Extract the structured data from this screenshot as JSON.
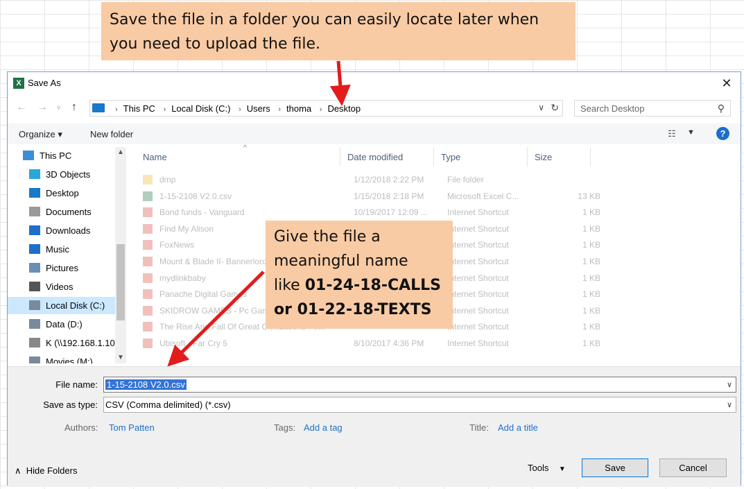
{
  "callouts": {
    "top": {
      "line1": "Save the file in a folder you can easily locate later when",
      "line2": "you need to upload the file."
    },
    "mid": {
      "line1": "Give the file a",
      "line2": "meaningful name",
      "line3_prefix": "like ",
      "line3_bold": "01-24-18-CALLS",
      "line4_bold": "or 01-22-18-TEXTS"
    }
  },
  "dialog": {
    "title": "Save As",
    "breadcrumb": [
      "This PC",
      "Local Disk (C:)",
      "Users",
      "thoma",
      "Desktop"
    ],
    "search_placeholder": "Search Desktop",
    "toolbar": {
      "organize": "Organize ▾",
      "new_folder": "New folder"
    }
  },
  "nav_pane": [
    {
      "label": "This PC",
      "icon": "computer-icon",
      "indent": 0
    },
    {
      "label": "3D Objects",
      "icon": "3d-objects-icon",
      "indent": 1
    },
    {
      "label": "Desktop",
      "icon": "desktop-icon",
      "indent": 1
    },
    {
      "label": "Documents",
      "icon": "documents-icon",
      "indent": 1
    },
    {
      "label": "Downloads",
      "icon": "downloads-icon",
      "indent": 1
    },
    {
      "label": "Music",
      "icon": "music-icon",
      "indent": 1
    },
    {
      "label": "Pictures",
      "icon": "pictures-icon",
      "indent": 1
    },
    {
      "label": "Videos",
      "icon": "videos-icon",
      "indent": 1
    },
    {
      "label": "Local Disk (C:)",
      "icon": "drive-icon",
      "indent": 1,
      "selected": true
    },
    {
      "label": "Data (D:)",
      "icon": "drive-icon",
      "indent": 1
    },
    {
      "label": "K (\\\\192.168.1.10",
      "icon": "network-drive-icon",
      "indent": 1
    },
    {
      "label": "Movies (M:)",
      "icon": "drive-icon",
      "indent": 1
    }
  ],
  "file_list": {
    "columns": [
      "Name",
      "Date modified",
      "Type",
      "Size"
    ],
    "rows": [
      {
        "name": "dmp",
        "date": "1/12/2018 2:22 PM",
        "type": "File folder",
        "size": ""
      },
      {
        "name": "1-15-2108 V2.0.csv",
        "date": "1/15/2018 2:18 PM",
        "type": "Microsoft Excel C...",
        "size": "13 KB"
      },
      {
        "name": "Bond funds - Vanguard",
        "date": "10/19/2017 12:09 ...",
        "type": "Internet Shortcut",
        "size": "1 KB"
      },
      {
        "name": "Find My Alison",
        "date": "",
        "type": "Internet Shortcut",
        "size": "1 KB"
      },
      {
        "name": "FoxNews",
        "date": "",
        "type": "Internet Shortcut",
        "size": "1 KB"
      },
      {
        "name": "Mount & Blade II- Bannerlord",
        "date": "",
        "type": "Internet Shortcut",
        "size": "1 KB"
      },
      {
        "name": "mydlinkbaby",
        "date": "",
        "type": "Internet Shortcut",
        "size": "1 KB"
      },
      {
        "name": "Panache Digital Games",
        "date": "",
        "type": "Internet Shortcut",
        "size": "1 KB"
      },
      {
        "name": "SKIDROW GAMES - Pc Games",
        "date": "",
        "type": "Internet Shortcut",
        "size": "1 KB"
      },
      {
        "name": "The Rise And Fall Of Great Civilizations - V...",
        "date": "",
        "type": "Internet Shortcut",
        "size": "1 KB"
      },
      {
        "name": "Ubisoft - Far Cry 5",
        "date": "8/10/2017 4:36 PM",
        "type": "Internet Shortcut",
        "size": "1 KB"
      }
    ]
  },
  "bottom": {
    "file_name_label": "File name:",
    "file_name_value": "1-15-2108 V2.0.csv",
    "save_type_label": "Save as type:",
    "save_type_value": "CSV (Comma delimited) (*.csv)",
    "authors_label": "Authors:",
    "authors_value": "Tom Patten",
    "tags_label": "Tags:",
    "tags_value": "Add a tag",
    "title_label": "Title:",
    "title_value": "Add a title",
    "hide_folders": "Hide Folders",
    "tools": "Tools",
    "save": "Save",
    "cancel": "Cancel"
  },
  "colors": {
    "accent": "#1d6fc9",
    "callout": "#f9cba4",
    "arrow": "#e31b1b",
    "selection": "#3373d4"
  }
}
